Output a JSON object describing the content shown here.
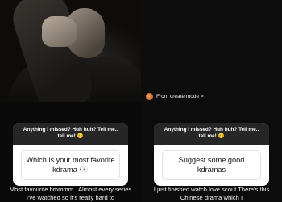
{
  "top_right": {
    "create_mode_label": "From create mode >"
  },
  "question_left": {
    "header": "Anything I missed? Huh huh? Tell me.. tell me! 😊",
    "question": "Which is your most favorite kdrama 👀",
    "answer": "Most favourite hmmmm.. Almost every series I've watched so it's really hard to"
  },
  "question_right": {
    "header": "Anything I missed? Huh huh? Tell me.. tell me! 😊",
    "question": "Suggest some good kdramas",
    "answer": "I just finished watch love scout There's this Chinese drama which I"
  },
  "colors": {
    "card_header": "#262626",
    "background": "#0b0b0b"
  }
}
